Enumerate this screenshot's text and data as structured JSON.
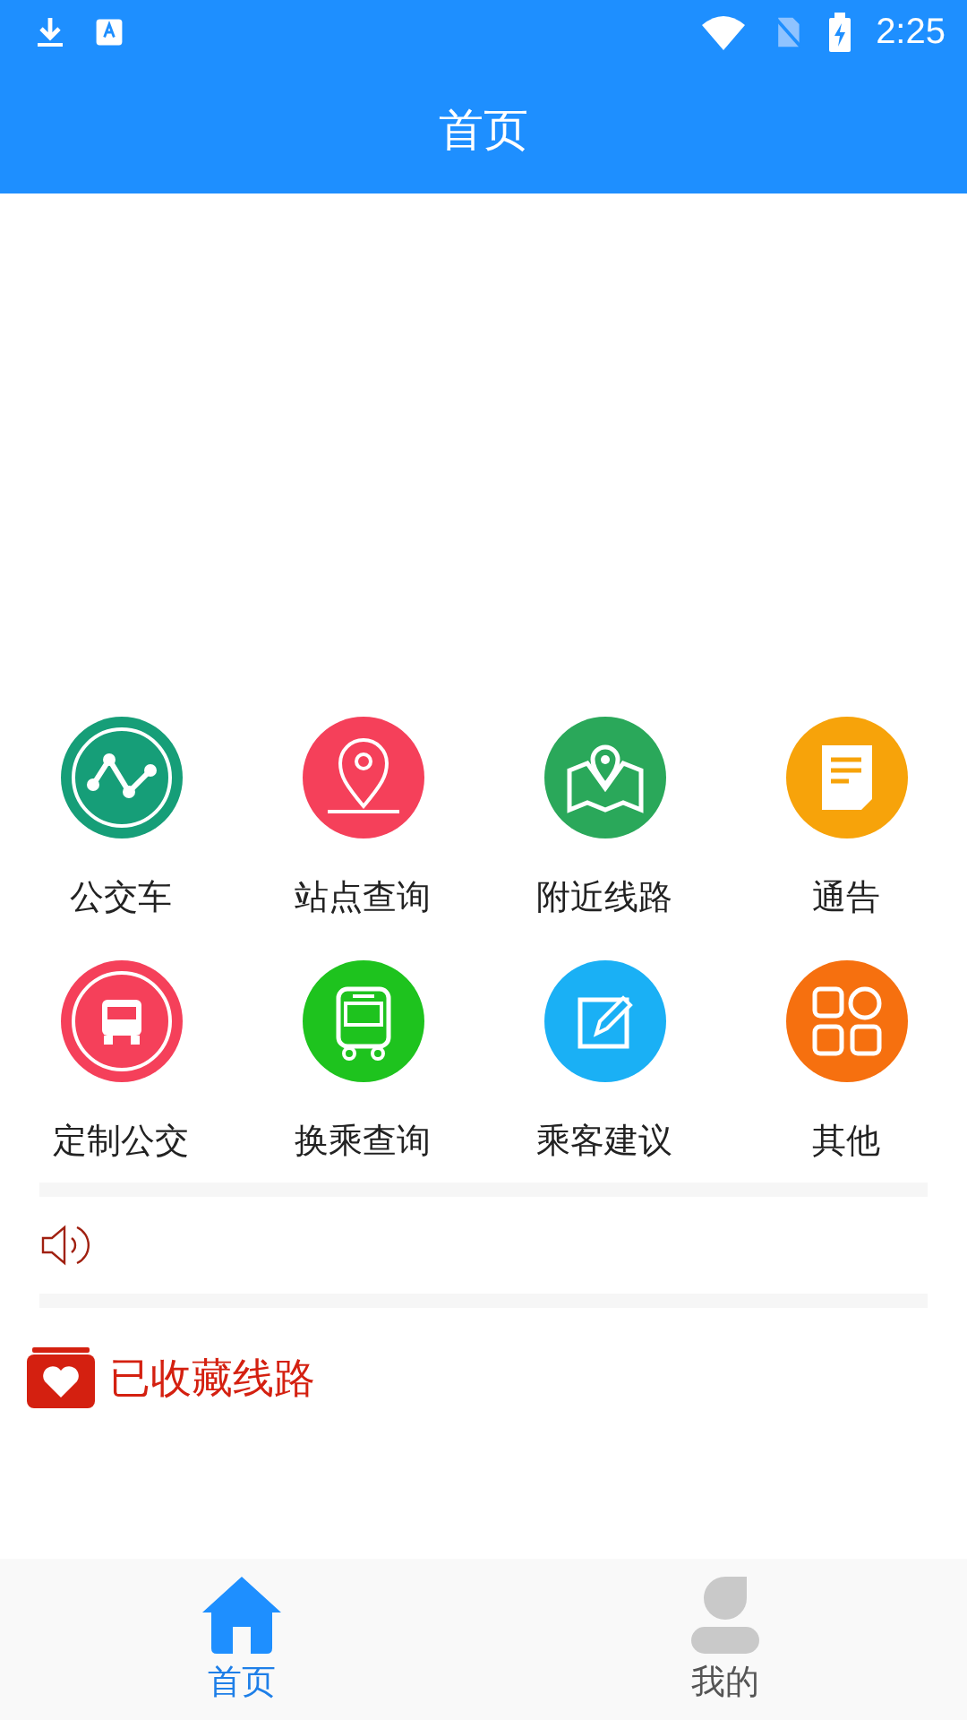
{
  "status_bar": {
    "time": "2:25"
  },
  "header": {
    "title": "首页"
  },
  "grid": [
    {
      "label": "公交车",
      "kind": "route",
      "color": "#169e78"
    },
    {
      "label": "站点查询",
      "kind": "pin",
      "color": "#f5405a"
    },
    {
      "label": "附近线路",
      "kind": "map",
      "color": "#2aa85a"
    },
    {
      "label": "通告",
      "kind": "notice",
      "color": "#f7a30a"
    },
    {
      "label": "定制公交",
      "kind": "bus",
      "color": "#f5405a"
    },
    {
      "label": "换乘查询",
      "kind": "transfer",
      "color": "#1ec31e"
    },
    {
      "label": "乘客建议",
      "kind": "edit",
      "color": "#1ab0f5"
    },
    {
      "label": "其他",
      "kind": "apps",
      "color": "#f6700f"
    }
  ],
  "favorites": {
    "title": "已收藏线路"
  },
  "tabs": [
    {
      "label": "首页",
      "kind": "home",
      "selected": true
    },
    {
      "label": "我的",
      "kind": "user",
      "selected": false
    }
  ]
}
